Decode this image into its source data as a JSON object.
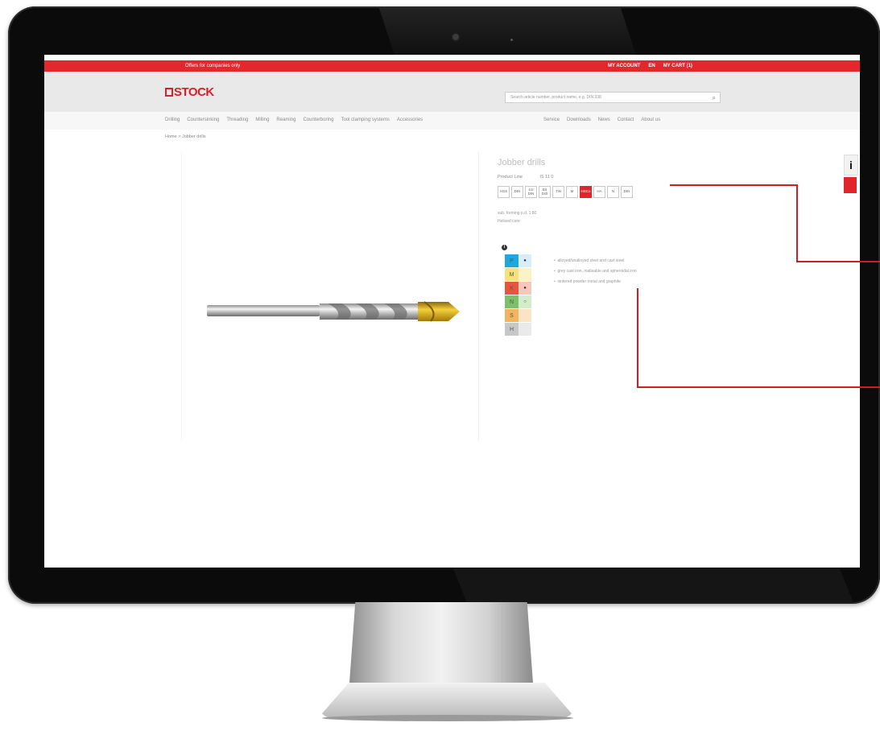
{
  "topbar": {
    "promo": "Offers for companies only",
    "account": "MY ACCOUNT",
    "language": "EN",
    "cart": "MY CART (1)"
  },
  "header": {
    "logo_text": "STOCK",
    "search_placeholder": "Search article number, product name, e.g. DIN 338"
  },
  "nav": {
    "left": [
      "Drilling",
      "Countersinking",
      "Threading",
      "Milling",
      "Reaming",
      "Counterboring",
      "Tool clamping systems",
      "Accessories"
    ],
    "right": [
      "Service",
      "Downloads",
      "News",
      "Contact",
      "About us"
    ]
  },
  "breadcrumb": "Home > Jobber drills",
  "product": {
    "title": "Jobber drills",
    "group_label": "Product Line",
    "group_value": "IS 11 0",
    "badges": [
      "HSS",
      "DIN",
      "1/2 DIN",
      "Bit Drill",
      "TiN",
      "M",
      "HSCo",
      "HA",
      "N",
      "DIN"
    ],
    "specs": [
      "sub. forming p.d. 1:80",
      "Helixed core"
    ]
  },
  "materials": {
    "rows": [
      {
        "letter": "P",
        "mark": "●",
        "color": "#1fa8e0",
        "mark_color": "#d7eef9"
      },
      {
        "letter": "M",
        "mark": "",
        "color": "#f6e27a",
        "mark_color": "#fbf3c6"
      },
      {
        "letter": "K",
        "mark": "●",
        "color": "#e8553e",
        "mark_color": "#f6c7bd"
      },
      {
        "letter": "N",
        "mark": "○",
        "color": "#7cc067",
        "mark_color": "#d3ecc9"
      },
      {
        "letter": "S",
        "mark": "",
        "color": "#f4b35f",
        "mark_color": "#fbe3c3"
      },
      {
        "letter": "H",
        "mark": "",
        "color": "#c7c7c7",
        "mark_color": "#eaeaea"
      }
    ],
    "descriptions": [
      "alloyed/unalloyed steel and cast steel",
      "grey cast iron, malleable and spheroidal iron",
      "sintered powder metal and graphite"
    ]
  },
  "sidebar": {
    "info_glyph": "i"
  },
  "monitor": {
    "bezel_color": "#0b0b0b",
    "accent_color": "#e4262d",
    "callout_color": "#d11c24"
  }
}
